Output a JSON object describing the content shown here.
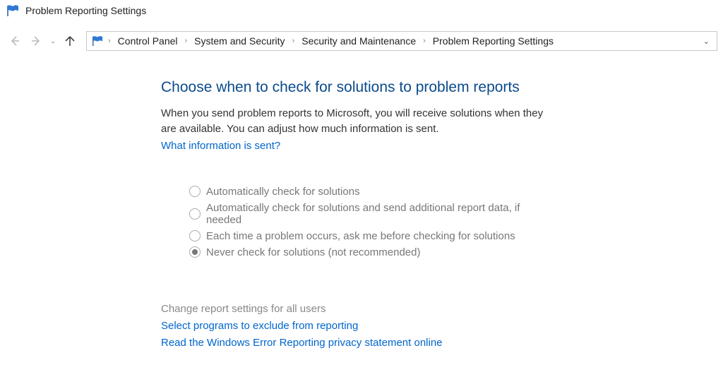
{
  "window": {
    "title": "Problem Reporting Settings"
  },
  "breadcrumb": {
    "items": [
      {
        "label": "Control Panel"
      },
      {
        "label": "System and Security"
      },
      {
        "label": "Security and Maintenance"
      },
      {
        "label": "Problem Reporting Settings"
      }
    ]
  },
  "main": {
    "heading": "Choose when to check for solutions to problem reports",
    "body": "When you send problem reports to Microsoft, you will receive solutions when they are available. You can adjust how much information is sent.",
    "info_link": "What information is sent?"
  },
  "options": [
    {
      "label": "Automatically check for solutions",
      "checked": false,
      "enabled": false
    },
    {
      "label": "Automatically check for solutions and send additional report data, if needed",
      "checked": false,
      "enabled": false
    },
    {
      "label": "Each time a problem occurs, ask me before checking for solutions",
      "checked": false,
      "enabled": false
    },
    {
      "label": "Never check for solutions (not recommended)",
      "checked": true,
      "enabled": false
    }
  ],
  "footer": {
    "change_all": "Change report settings for all users",
    "exclude": "Select programs to exclude from reporting",
    "privacy": "Read the Windows Error Reporting privacy statement online"
  }
}
